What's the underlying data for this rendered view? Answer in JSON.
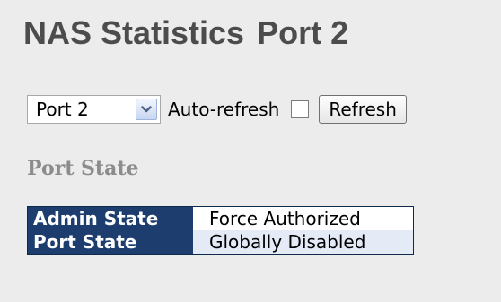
{
  "page": {
    "title": "NAS Statistics",
    "port_label": "Port 2"
  },
  "controls": {
    "port_select": {
      "selected": "Port 2",
      "arrow_icon": "chevron-down-icon"
    },
    "auto_refresh_label": "Auto-refresh",
    "auto_refresh_checked": false,
    "refresh_label": "Refresh"
  },
  "section": {
    "heading": "Port State"
  },
  "port_state_table": {
    "rows": [
      {
        "label": "Admin State",
        "value": "Force Authorized"
      },
      {
        "label": "Port State",
        "value": "Globally Disabled"
      }
    ]
  },
  "colors": {
    "page_background": "#ececec",
    "title_text": "#4c4c4c",
    "section_heading": "#8c8c8c",
    "table_header_bg": "#1c3d6e",
    "table_alt_row_bg": "#e4ebf7"
  }
}
